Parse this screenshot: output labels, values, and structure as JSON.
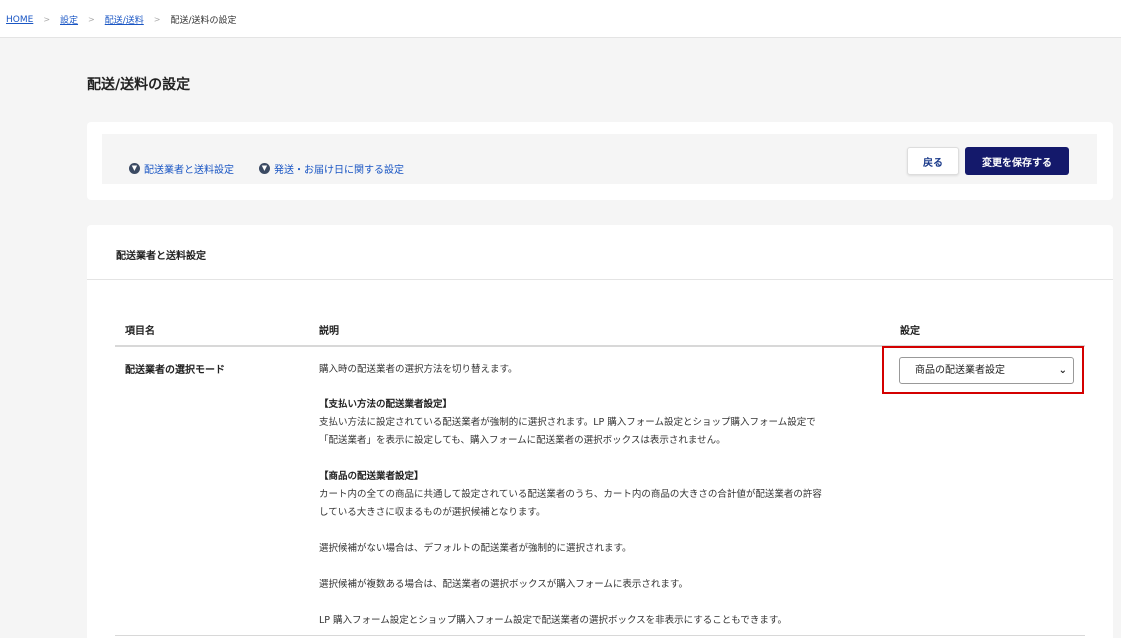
{
  "breadcrumb": {
    "home": "HOME",
    "settings": "設定",
    "shipping": "配送/送料",
    "current": "配送/送料の設定",
    "separator": ">"
  },
  "page": {
    "title": "配送/送料の設定"
  },
  "toolbar": {
    "anchor1": "配送業者と送料設定",
    "anchor2": "発送・お届け日に関する設定",
    "back_label": "戻る",
    "save_label": "変更を保存する"
  },
  "section": {
    "title": "配送業者と送料設定",
    "columns": {
      "item": "項目名",
      "description": "説明",
      "setting": "設定"
    },
    "row": {
      "label": "配送業者の選択モード",
      "description": [
        {
          "text": "購入時の配送業者の選択方法を切り替えます。",
          "bold": false
        },
        {
          "text": "【支払い方法の配送業者設定】",
          "bold": true
        },
        {
          "text": "支払い方法に設定されている配送業者が強制的に選択されます。LP 購入フォーム設定とショップ購入フォーム設定で",
          "bold": false
        },
        {
          "text": "「配送業者」を表示に設定しても、購入フォームに配送業者の選択ボックスは表示されません。",
          "bold": false
        },
        {
          "text": "【商品の配送業者設定】",
          "bold": true
        },
        {
          "text": "カート内の全ての商品に共通して設定されている配送業者のうち、カート内の商品の大きさの合計値が配送業者の許容",
          "bold": false
        },
        {
          "text": "している大きさに収まるものが選択候補となります。",
          "bold": false
        },
        {
          "text": "選択候補がない場合は、デフォルトの配送業者が強制的に選択されます。",
          "bold": false
        },
        {
          "text": "選択候補が複数ある場合は、配送業者の選択ボックスが購入フォームに表示されます。",
          "bold": false
        },
        {
          "text": "LP 購入フォーム設定とショップ購入フォーム設定で配送業者の選択ボックスを非表示にすることもできます。",
          "bold": false
        }
      ],
      "select_value": "商品の配送業者設定"
    }
  },
  "colors": {
    "accent": "#14196b",
    "link": "#1a56c4",
    "highlight": "#d40000"
  }
}
